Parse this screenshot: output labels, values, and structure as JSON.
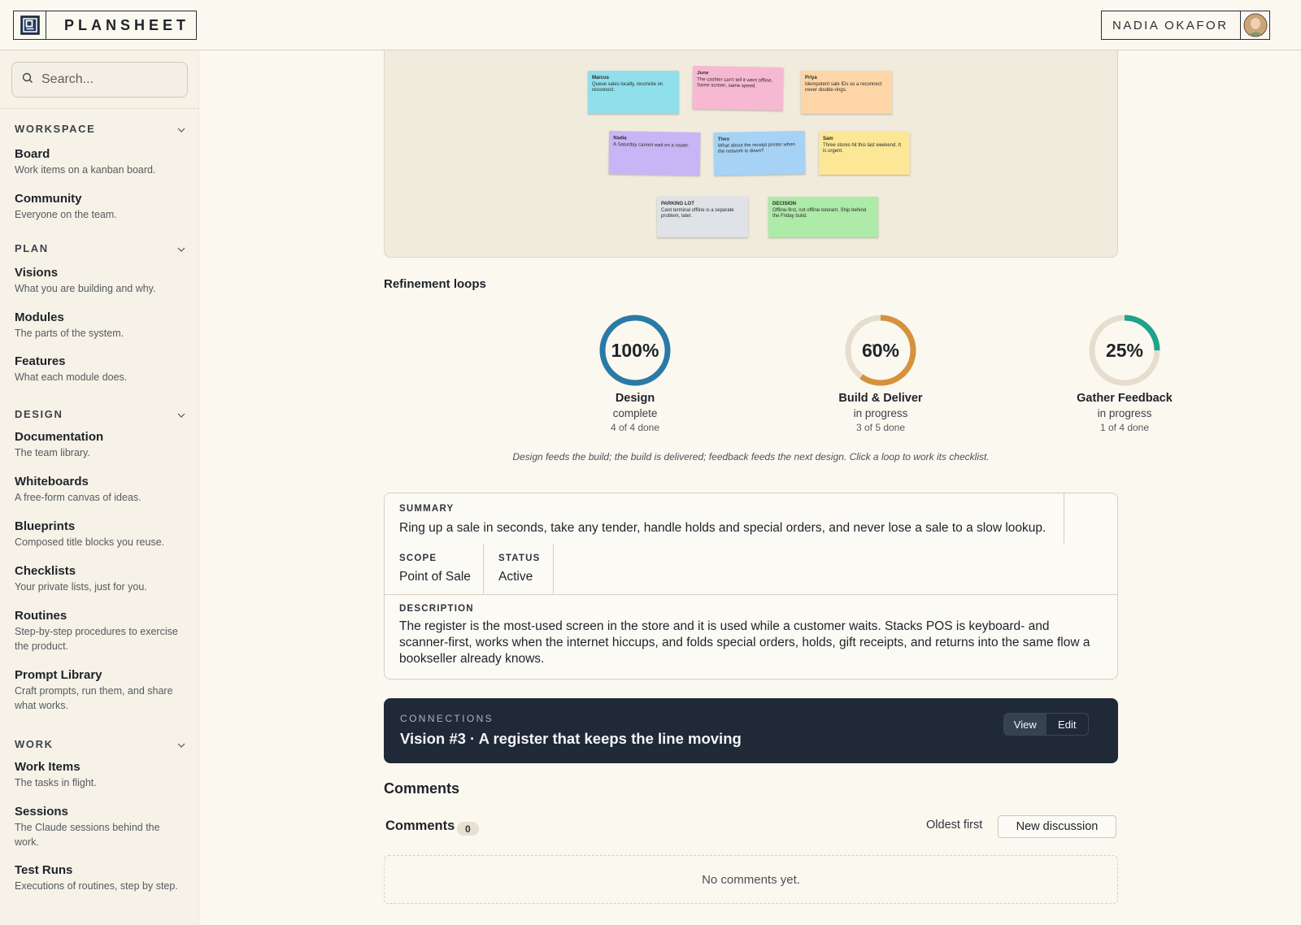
{
  "app": {
    "name": "PLANSHEET",
    "user": "NADIA OKAFOR"
  },
  "search": {
    "placeholder": "Search..."
  },
  "sidebar": {
    "sections": [
      {
        "label": "WORKSPACE",
        "items": [
          {
            "title": "Board",
            "subtitle": "Work items on a kanban board."
          },
          {
            "title": "Community",
            "subtitle": "Everyone on the team."
          }
        ]
      },
      {
        "label": "PLAN",
        "items": [
          {
            "title": "Visions",
            "subtitle": "What you are building and why."
          },
          {
            "title": "Modules",
            "subtitle": "The parts of the system."
          },
          {
            "title": "Features",
            "subtitle": "What each module does."
          }
        ]
      },
      {
        "label": "DESIGN",
        "items": [
          {
            "title": "Documentation",
            "subtitle": "The team library."
          },
          {
            "title": "Whiteboards",
            "subtitle": "A free-form canvas of ideas."
          },
          {
            "title": "Blueprints",
            "subtitle": "Composed title blocks you reuse."
          },
          {
            "title": "Checklists",
            "subtitle": "Your private lists, just for you."
          },
          {
            "title": "Routines",
            "subtitle": "Step-by-step procedures to exercise the product."
          },
          {
            "title": "Prompt Library",
            "subtitle": "Craft prompts, run them, and share what works."
          }
        ]
      },
      {
        "label": "WORK",
        "items": [
          {
            "title": "Work Items",
            "subtitle": "The tasks in flight."
          },
          {
            "title": "Sessions",
            "subtitle": "The Claude sessions behind the work."
          },
          {
            "title": "Test Runs",
            "subtitle": "Executions of routines, step by step."
          }
        ]
      }
    ]
  },
  "whiteboard": {
    "stickies": [
      {
        "author": "Marcus",
        "text": "Queue sales locally, reconcile on reconnect.",
        "color": "#8fe0ea"
      },
      {
        "author": "June",
        "text": "The cashier can't tell it went offline. Same screen, same speed.",
        "color": "#f7b8d2"
      },
      {
        "author": "Priya",
        "text": "Idempotent sale IDs so a reconnect never double-rings.",
        "color": "#fdd5a6"
      },
      {
        "author": "Nadia",
        "text": "A Saturday cannot wait on a router.",
        "color": "#c7b6f5"
      },
      {
        "author": "Theo",
        "text": "What about the receipt printer when the network is down?",
        "color": "#a6d3f5"
      },
      {
        "author": "Sam",
        "text": "Three stores hit this last weekend. It is urgent.",
        "color": "#fbe795"
      },
      {
        "author": "PARKING LOT",
        "text": "Card terminal offline is a separate problem, later.",
        "color": "#dfe2e6"
      },
      {
        "author": "DECISION",
        "text": "Offline-first, not offline-tolerant. Ship behind the Friday build.",
        "color": "#aeeaa8"
      }
    ]
  },
  "refinement": {
    "heading": "Refinement loops",
    "loops": [
      {
        "pct_label": "100%",
        "progress": 1.0,
        "name": "Design",
        "state": "complete",
        "count": "4 of 4 done",
        "color": "#2a7aa8"
      },
      {
        "pct_label": "60%",
        "progress": 0.6,
        "name": "Build & Deliver",
        "state": "in progress",
        "count": "3 of 5 done",
        "color": "#d4923c"
      },
      {
        "pct_label": "25%",
        "progress": 0.25,
        "name": "Gather Feedback",
        "state": "in progress",
        "count": "1 of 4 done",
        "color": "#1fa38a"
      }
    ],
    "caption": "Design feeds the build; the build is delivered; feedback feeds the next design. Click a loop to work its checklist."
  },
  "detail": {
    "summary_label": "SUMMARY",
    "summary": "Ring up a sale in seconds, take any tender, handle holds and special orders, and never lose a sale to a slow lookup.",
    "scope_label": "SCOPE",
    "scope": "Point of Sale",
    "status_label": "STATUS",
    "status": "Active",
    "description_label": "DESCRIPTION",
    "description": "The register is the most-used screen in the store and it is used while a customer waits. Stacks POS is keyboard- and scanner-first, works when the internet hiccups, and folds special orders, holds, gift receipts, and returns into the same flow a bookseller already knows."
  },
  "connections": {
    "label": "CONNECTIONS",
    "title": "Vision #3 · A register that keeps the line moving",
    "view_label": "View",
    "edit_label": "Edit"
  },
  "comments": {
    "heading": "Comments",
    "subheading": "Comments",
    "count": "0",
    "sort_label": "Oldest first",
    "new_label": "New discussion",
    "empty": "No comments yet."
  }
}
